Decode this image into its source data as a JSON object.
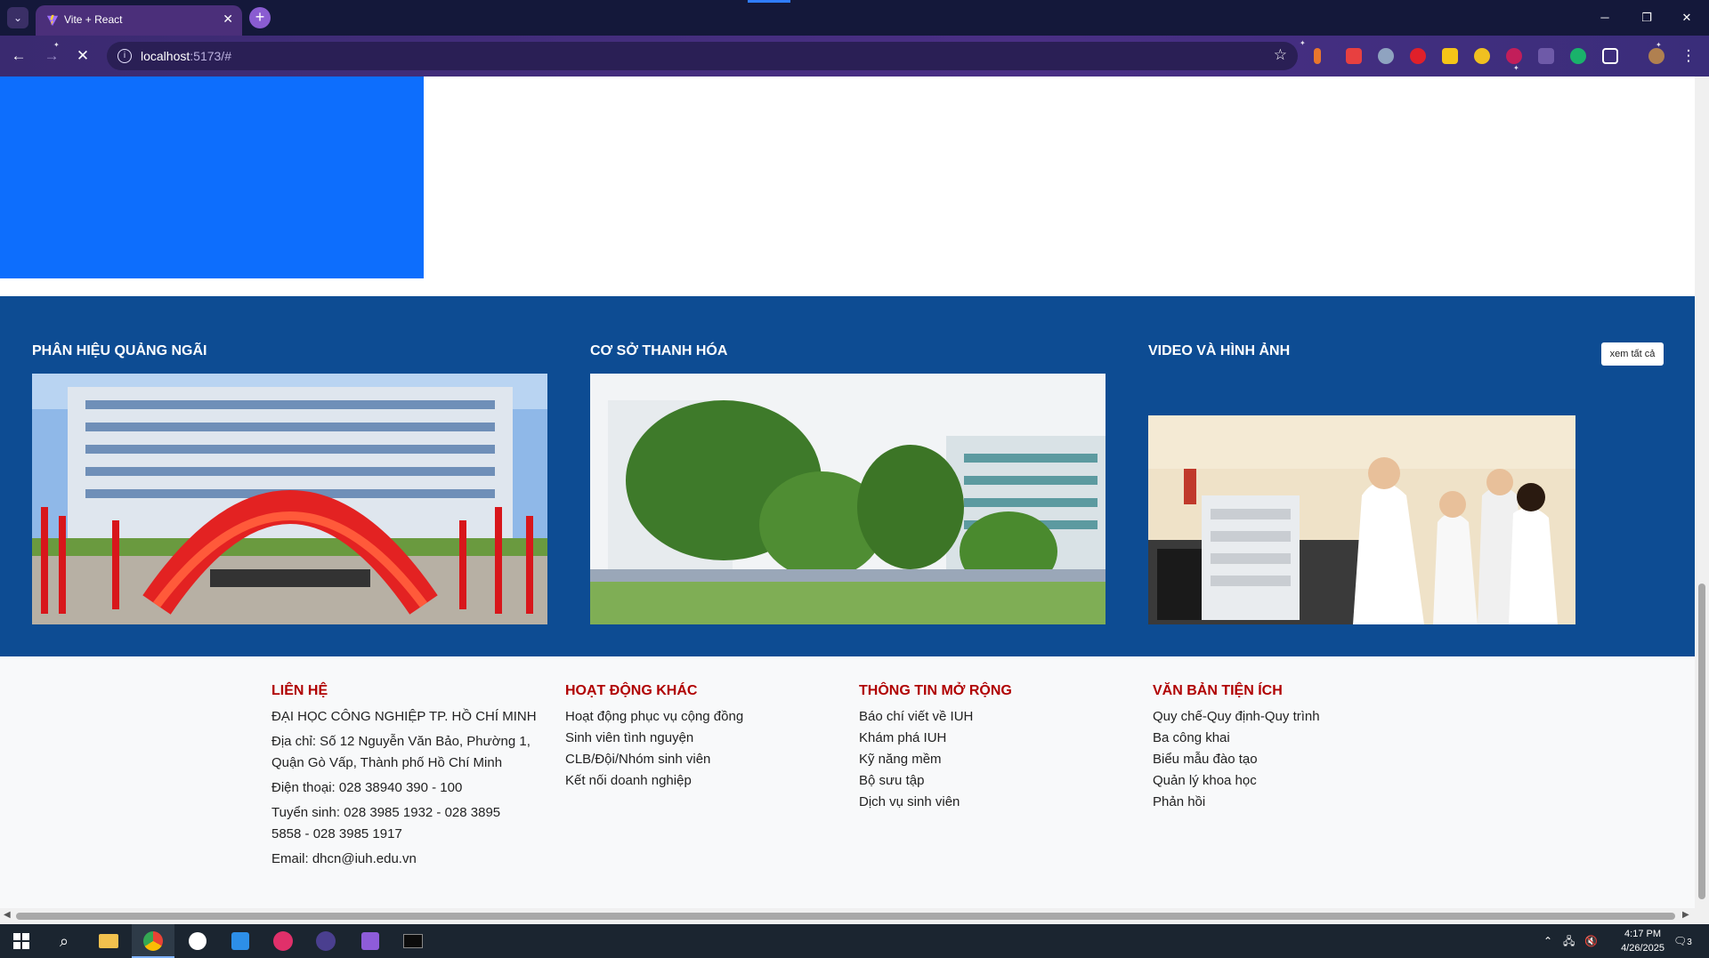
{
  "browser": {
    "tab_title": "Vite + React",
    "url_host": "localhost",
    "url_rest": ":5173/#"
  },
  "campus": {
    "left_title": "PHÂN HIỆU QUẢNG NGÃI",
    "middle_title": "CƠ SỞ THANH HÓA",
    "right_title": "VIDEO VÀ HÌNH ẢNH",
    "view_all": "xem tất cả"
  },
  "footer": {
    "contact": {
      "heading": "LIÊN HỆ",
      "university": "ĐẠI HỌC CÔNG NGHIỆP TP. HỒ CHÍ MINH",
      "address_line1": "Địa chỉ: Số 12 Nguyễn Văn Bảo, Phường 1,",
      "address_line2": "Quận Gò Vấp, Thành phố Hồ Chí Minh",
      "phone": "Điện thoại: 028 38940 390 - 100",
      "admission_line1": "Tuyển sinh: 028 3985 1932 - 028 3895",
      "admission_line2": "5858 - 028 3985 1917",
      "email": "Email: dhcn@iuh.edu.vn"
    },
    "activities": {
      "heading": "HOẠT ĐỘNG KHÁC",
      "items": [
        "Hoạt động phục vụ cộng đồng",
        "Sinh viên tình nguyện",
        "CLB/Đội/Nhóm sinh viên",
        "Kết nối doanh nghiệp"
      ]
    },
    "more_info": {
      "heading": "THÔNG TIN MỞ RỘNG",
      "items": [
        "Báo chí viết về IUH",
        "Khám phá IUH",
        "Kỹ năng mềm",
        "Bộ sưu tập",
        "Dịch vụ sinh viên"
      ]
    },
    "documents": {
      "heading": "VĂN BẢN TIỆN ÍCH",
      "items": [
        "Quy chế-Quy định-Quy trình",
        "Ba công khai",
        "Biểu mẫu đào tạo",
        "Quản lý khoa học",
        "Phản hồi"
      ]
    }
  },
  "taskbar": {
    "time": "4:17 PM",
    "date": "4/26/2025",
    "notifications": "3"
  }
}
